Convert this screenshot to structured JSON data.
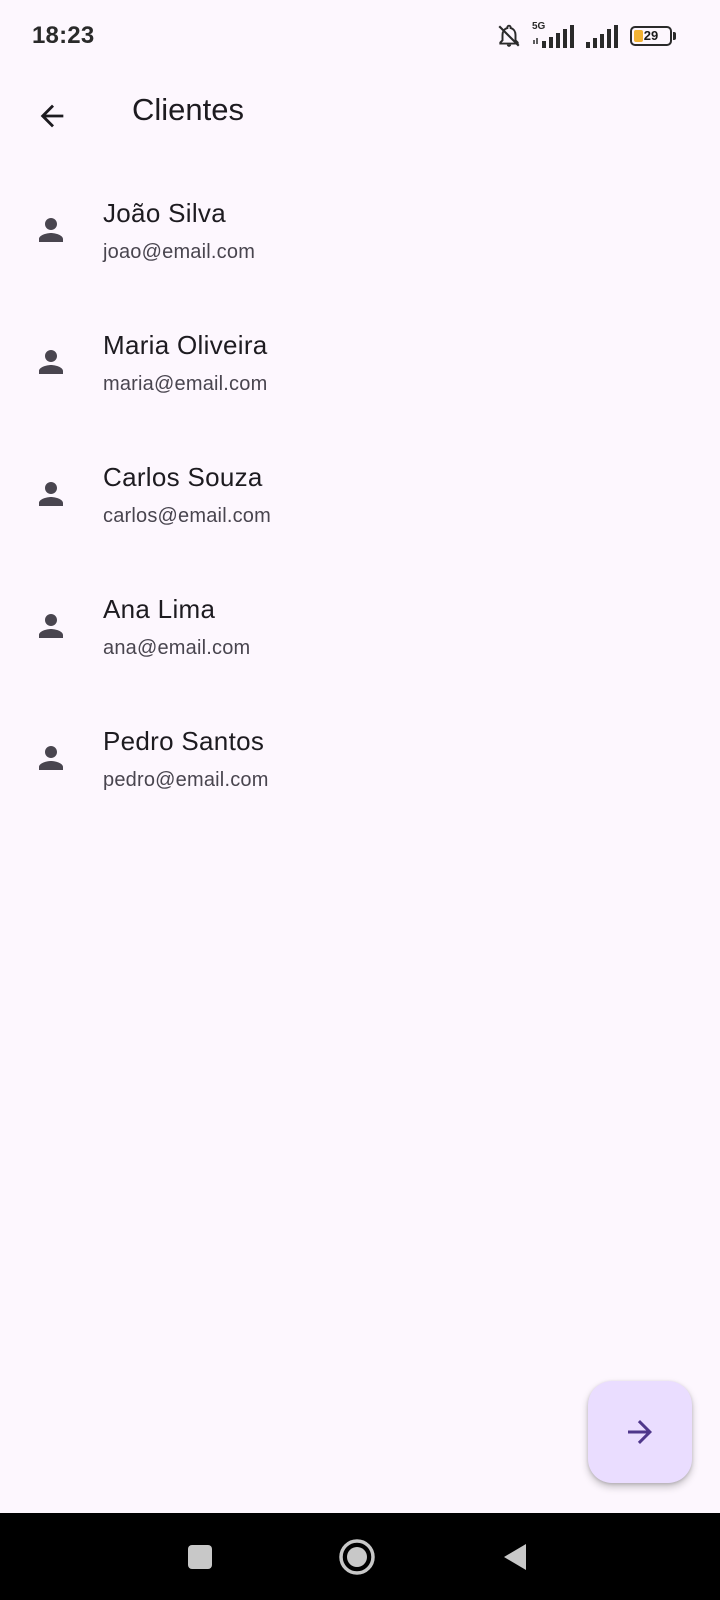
{
  "status_bar": {
    "time": "18:23",
    "network_label": "5G",
    "battery_level": "29",
    "icons": [
      "bell-off-icon",
      "signal-5g-icon",
      "signal-icon",
      "battery-icon"
    ]
  },
  "app_bar": {
    "title": "Clientes",
    "back_icon": "arrow-left-icon"
  },
  "clients": [
    {
      "name": "João Silva",
      "email": "joao@email.com"
    },
    {
      "name": "Maria Oliveira",
      "email": "maria@email.com"
    },
    {
      "name": "Carlos Souza",
      "email": "carlos@email.com"
    },
    {
      "name": "Ana Lima",
      "email": "ana@email.com"
    },
    {
      "name": "Pedro Santos",
      "email": "pedro@email.com"
    }
  ],
  "fab": {
    "icon": "arrow-right-icon",
    "color": "#eaddff",
    "icon_color": "#4f378b"
  },
  "nav_bar": {
    "buttons": [
      "recents-square-icon",
      "home-circle-icon",
      "back-triangle-icon"
    ]
  },
  "colors": {
    "background": "#fdf7fe",
    "text_primary": "#1d1b20",
    "text_secondary": "#49454f",
    "icon": "#49454f"
  }
}
